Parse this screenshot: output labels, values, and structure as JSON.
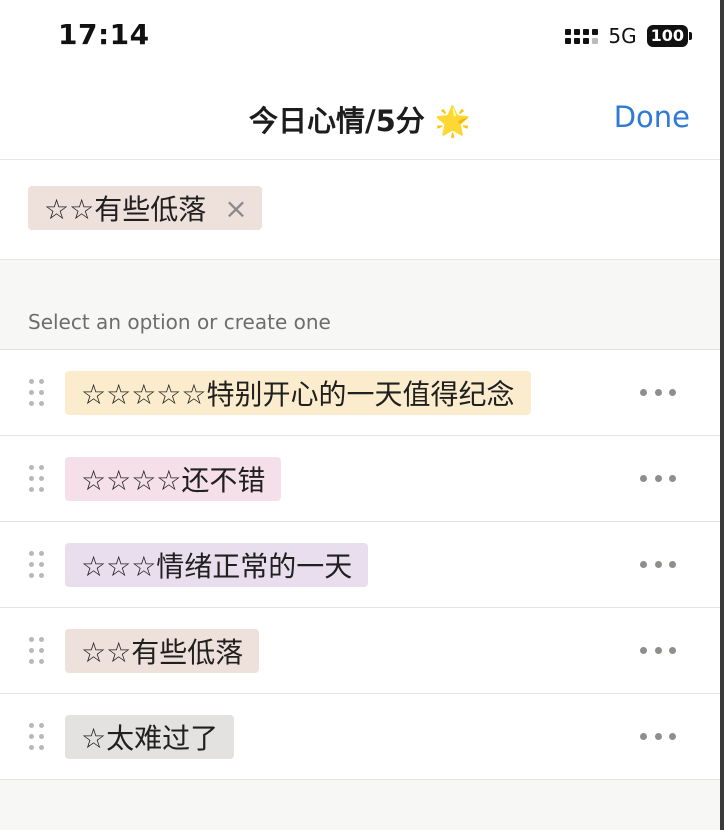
{
  "status_bar": {
    "time": "17:14",
    "network": "5G",
    "battery": "100"
  },
  "nav": {
    "title": "今日心情/5分 🌟",
    "done_label": "Done"
  },
  "selected": {
    "label": "☆☆有些低落",
    "remove_icon": "×",
    "color": "#eee0da"
  },
  "section_header": "Select an option or create one",
  "options": [
    {
      "label": "☆☆☆☆☆特别开心的一天值得纪念",
      "color": "#fbeccd"
    },
    {
      "label": "☆☆☆☆还不错",
      "color": "#f5e0e9"
    },
    {
      "label": "☆☆☆情绪正常的一天",
      "color": "#e8deee"
    },
    {
      "label": "☆☆有些低落",
      "color": "#eee0da"
    },
    {
      "label": "☆太难过了",
      "color": "#e3e2e0"
    }
  ],
  "icons": {
    "drag": "drag-handle-icon",
    "more": "more-horizontal-icon",
    "remove": "close-icon"
  }
}
